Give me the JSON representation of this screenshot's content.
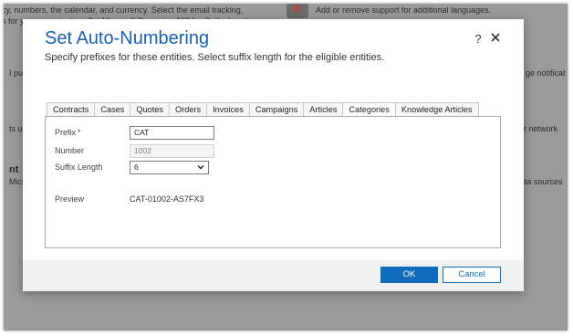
{
  "background": {
    "lines": [
      "cy, numbers, the calendar, and currency. Select the email tracking,",
      "s for your organization. Set Microsoft Dynamics 365 for Outlook options.",
      "I pu",
      "ge notificat",
      "ts u",
      "her network",
      "nt",
      "Micr",
      "ata sources"
    ],
    "right_line": "Add or remove support for additional languages."
  },
  "dialog": {
    "title": "Set Auto-Numbering",
    "subtitle": "Specify prefixes for these entities. Select suffix length for the eligible entities.",
    "help_label": "?",
    "tabs": [
      "Contracts",
      "Cases",
      "Quotes",
      "Orders",
      "Invoices",
      "Campaigns",
      "Articles",
      "Categories",
      "Knowledge Articles"
    ],
    "active_tab": "Categories",
    "form": {
      "prefix_label": "Prefix",
      "required_marker": "*",
      "prefix_value": "CAT",
      "number_label": "Number",
      "number_value": "1002",
      "suffix_label": "Suffix Length",
      "suffix_value": "6",
      "preview_label": "Preview",
      "preview_value": "CAT-01002-AS7FX3"
    },
    "buttons": {
      "ok": "OK",
      "cancel": "Cancel"
    }
  },
  "colors": {
    "accent": "#0f6cbd",
    "title": "#1a5fb0",
    "required": "#c42b1c",
    "overlay": "#9a9a9a"
  },
  "icons": [
    "close-icon",
    "chevron-down-icon"
  ]
}
